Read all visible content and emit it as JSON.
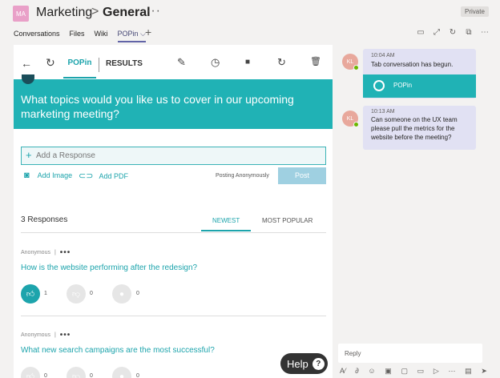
{
  "header": {
    "team_initials": "MA",
    "team_name": "Marketing",
    "separator": ">",
    "channel_name": "General",
    "more": "···",
    "privacy_badge": "Private",
    "tabs": [
      {
        "label": "Conversations"
      },
      {
        "label": "Files"
      },
      {
        "label": "Wiki"
      },
      {
        "label": "POPin ⌵"
      }
    ],
    "add_tab": "+",
    "toolbar_icons": [
      "chat-icon",
      "expand-icon",
      "refresh-icon",
      "popout-icon",
      "more-icon"
    ]
  },
  "app": {
    "toolbar": {
      "back_icon": "←",
      "refresh_icon": "↻",
      "popin_tab": "POPin",
      "results_tab": "RESULTS",
      "icons": {
        "edit": "✎",
        "history": "◷",
        "stop": "■",
        "reload": "↻",
        "delete": "🗑"
      }
    },
    "question": "What topics would you like us to cover in our upcoming marketing meeting?",
    "response_input": {
      "plus": "+",
      "placeholder": "Add a Response"
    },
    "attachments": {
      "add_image": "Add Image",
      "add_pdf": "Add PDF"
    },
    "posting_mode": "Posting Anonymously",
    "post_label": "Post",
    "responses_count": "3 Responses",
    "sort": {
      "newest": "NEWEST",
      "most_popular": "MOST POPULAR",
      "active": "newest"
    },
    "entries": [
      {
        "author": "Anonymous",
        "sep": "|",
        "more": "•••",
        "text": "How is the website performing after the redesign?",
        "upvotes": "1",
        "downvotes": "0",
        "comments": "0"
      },
      {
        "author": "Anonymous",
        "sep": "|",
        "more": "•••",
        "text": "What new search campaigns are the most successful?",
        "upvotes": "0",
        "downvotes": "0",
        "comments": "0"
      }
    ],
    "help": {
      "label": "Help",
      "icon": "?"
    }
  },
  "chat": {
    "messages": [
      {
        "initials": "KL",
        "time": "10:04 AM",
        "text": "Tab conversation has begun.",
        "card_label": "POPin"
      },
      {
        "initials": "KL",
        "time": "10:13 AM",
        "text": "Can someone on the UX team please pull the metrics for the website before the meeting?"
      }
    ],
    "reply_placeholder": "Reply",
    "compose_icons": [
      "format-icon",
      "attach-icon",
      "emoji-icon",
      "gif-icon",
      "sticker-icon",
      "meet-icon",
      "stream-icon",
      "more-icon",
      "delete-icon",
      "send-icon"
    ]
  },
  "colors": {
    "accent_teal": "#20b2b5",
    "teams_purple": "#6264a7",
    "bubble": "#e1e1f3",
    "presence": "#6bb700"
  }
}
